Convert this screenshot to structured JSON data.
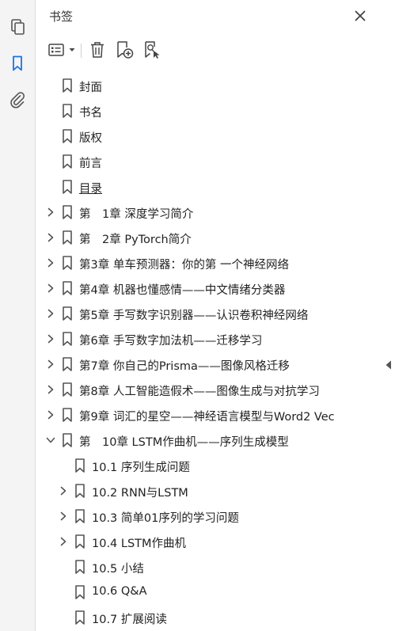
{
  "panel": {
    "title": "书签"
  },
  "bookmarks": [
    {
      "label": "封面",
      "level": 0,
      "expander": "none",
      "underline": false
    },
    {
      "label": "书名",
      "level": 0,
      "expander": "none",
      "underline": false
    },
    {
      "label": "版权",
      "level": 0,
      "expander": "none",
      "underline": false
    },
    {
      "label": "前言",
      "level": 0,
      "expander": "none",
      "underline": false
    },
    {
      "label": "目录",
      "level": 0,
      "expander": "none",
      "underline": true
    },
    {
      "label": "第　1章 深度学习简介",
      "level": 0,
      "expander": "collapsed",
      "underline": false
    },
    {
      "label": "第　2章 PyTorch简介",
      "level": 0,
      "expander": "collapsed",
      "underline": false
    },
    {
      "label": "第3章 单车预测器：你的第 一个神经网络",
      "level": 0,
      "expander": "collapsed",
      "underline": false
    },
    {
      "label": "第4章 机器也懂感情——中文情绪分类器",
      "level": 0,
      "expander": "collapsed",
      "underline": false
    },
    {
      "label": "第5章 手写数字识别器——认识卷积神经网络",
      "level": 0,
      "expander": "collapsed",
      "underline": false
    },
    {
      "label": "第6章 手写数字加法机——迁移学习",
      "level": 0,
      "expander": "collapsed",
      "underline": false
    },
    {
      "label": "第7章 你自己的Prisma——图像风格迁移",
      "level": 0,
      "expander": "collapsed",
      "underline": false
    },
    {
      "label": "第8章 人工智能造假术——图像生成与对抗学习",
      "level": 0,
      "expander": "collapsed",
      "underline": false
    },
    {
      "label": "第9章 词汇的星空——神经语言模型与Word2 Vec",
      "level": 0,
      "expander": "collapsed",
      "underline": false
    },
    {
      "label": "第　10章 LSTM作曲机——序列生成模型",
      "level": 0,
      "expander": "expanded",
      "underline": false
    },
    {
      "label": "10.1 序列生成问题",
      "level": 1,
      "expander": "none",
      "underline": false
    },
    {
      "label": "10.2 RNN与LSTM",
      "level": 1,
      "expander": "collapsed",
      "underline": false
    },
    {
      "label": "10.3 简单01序列的学习问题",
      "level": 1,
      "expander": "collapsed",
      "underline": false
    },
    {
      "label": "10.4 LSTM作曲机",
      "level": 1,
      "expander": "collapsed",
      "underline": false
    },
    {
      "label": "10.5 小结",
      "level": 1,
      "expander": "none",
      "underline": false
    },
    {
      "label": "10.6 Q&A",
      "level": 1,
      "expander": "none",
      "underline": false
    },
    {
      "label": "10.7 扩展阅读",
      "level": 1,
      "expander": "none",
      "underline": false
    }
  ]
}
